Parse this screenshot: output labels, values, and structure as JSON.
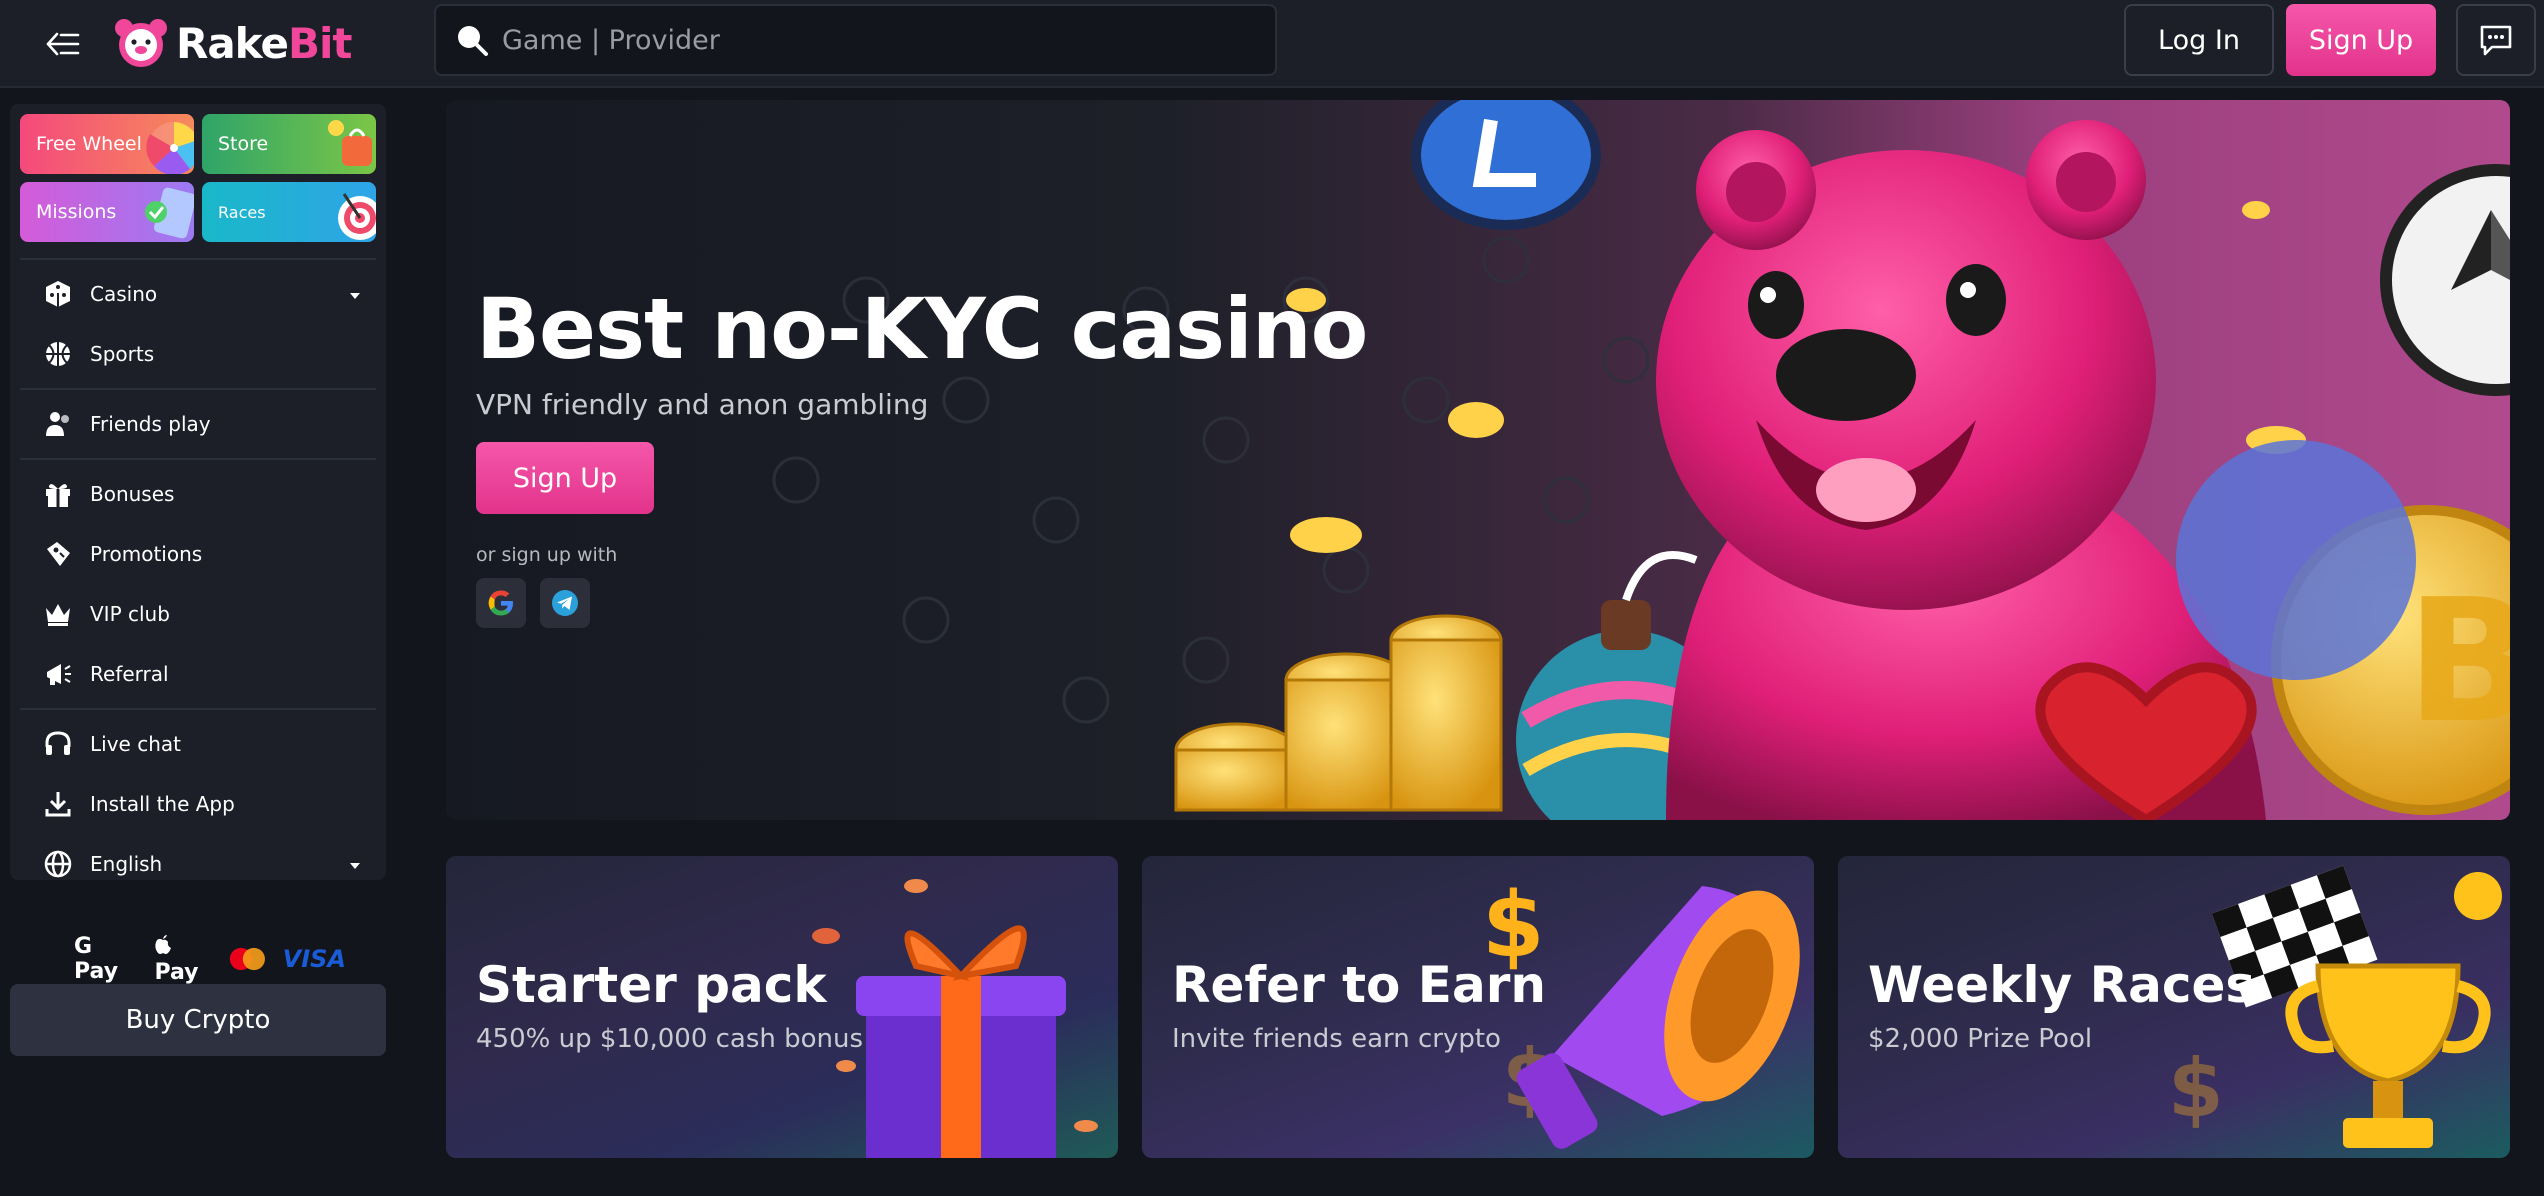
{
  "header": {
    "logo_part1": "Rake",
    "logo_part2": "Bit",
    "search_placeholder": "Game | Provider",
    "login_label": "Log In",
    "signup_label": "Sign Up"
  },
  "sidebar": {
    "promo_tiles": [
      {
        "label": "Free Wheel"
      },
      {
        "label": "Store"
      },
      {
        "label": "Missions"
      },
      {
        "label": "Races"
      }
    ],
    "items": [
      {
        "label": "Casino",
        "icon": "casino-cube-icon",
        "has_dropdown": true
      },
      {
        "label": "Sports",
        "icon": "basketball-icon"
      },
      {
        "label": "Friends play",
        "icon": "friends-icon"
      },
      {
        "label": "Bonuses",
        "icon": "gift-icon"
      },
      {
        "label": "Promotions",
        "icon": "ticket-icon"
      },
      {
        "label": "VIP club",
        "icon": "crown-icon"
      },
      {
        "label": "Referral",
        "icon": "megaphone-icon"
      },
      {
        "label": "Live chat",
        "icon": "headset-icon"
      },
      {
        "label": "Install the App",
        "icon": "download-icon"
      },
      {
        "label": "English",
        "icon": "globe-icon",
        "has_dropdown": true
      }
    ],
    "payments": {
      "gpay": "G Pay",
      "applepay": "Pay",
      "visa": "VISA"
    },
    "buy_crypto_label": "Buy Crypto"
  },
  "hero": {
    "title": "Best no-KYC casino",
    "subtitle": "VPN friendly and anon gambling",
    "signup_label": "Sign Up",
    "or_text": "or sign up with"
  },
  "cards": [
    {
      "title": "Starter pack",
      "subtitle": "450% up $10,000 cash bonus"
    },
    {
      "title": "Refer to Earn",
      "subtitle": "Invite friends earn crypto"
    },
    {
      "title": "Weekly Races",
      "subtitle": "$2,000 Prize Pool"
    }
  ],
  "colors": {
    "accent_pink": "#f0479a",
    "background": "#12151c",
    "panel": "#1c1f28"
  }
}
